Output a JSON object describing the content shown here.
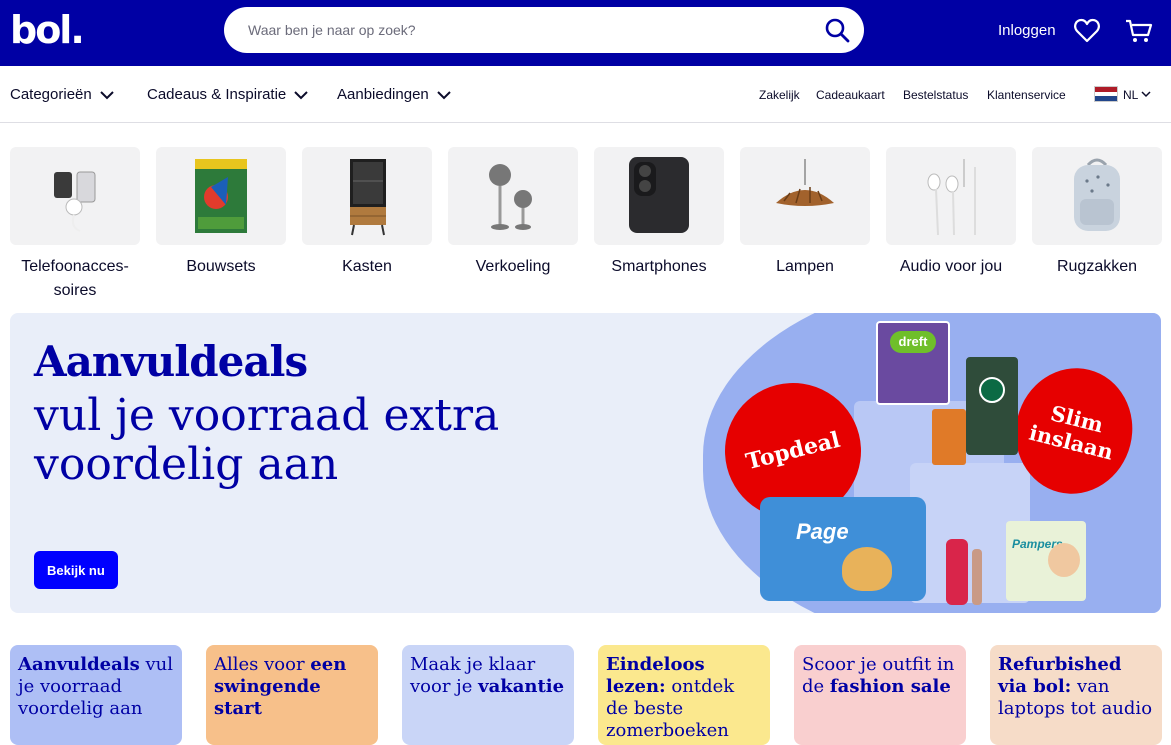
{
  "header": {
    "logo": "bol.",
    "search_placeholder": "Waar ben je naar op zoek?",
    "login_label": "Inloggen"
  },
  "nav": {
    "left": [
      "Categorieën",
      "Cadeaus & Inspiratie",
      "Aanbiedingen"
    ],
    "right": [
      "Zakelijk",
      "Cadeaukaart",
      "Bestelstatus",
      "Klantenservice"
    ],
    "language": "NL"
  },
  "categories": [
    {
      "label": "Telefoonacces-\nsoires",
      "icon": "phone-accessories-icon"
    },
    {
      "label": "Bouwsets",
      "icon": "building-set-icon"
    },
    {
      "label": "Kasten",
      "icon": "cabinet-icon"
    },
    {
      "label": "Verkoeling",
      "icon": "fan-icon"
    },
    {
      "label": "Smartphones",
      "icon": "smartphone-icon"
    },
    {
      "label": "Lampen",
      "icon": "lamp-icon"
    },
    {
      "label": "Audio voor jou",
      "icon": "earphones-icon"
    },
    {
      "label": "Rugzakken",
      "icon": "backpack-icon"
    }
  ],
  "hero": {
    "title": "Aanvuldeals",
    "subtitle": "vul je voorraad extra voordelig aan",
    "cta": "Bekijk nu",
    "badge_left": "Topdeal",
    "badge_right": "Slim inslaan",
    "product_labels": [
      "dreft",
      "Page",
      "Pampers"
    ]
  },
  "promos": [
    {
      "bold": "Aanvuldeals",
      "text": " vul je voorraad voordelig aan",
      "bold_first": true,
      "bg": "#aebff5"
    },
    {
      "text": "Alles voor ",
      "bold": "een swingende start",
      "bold_first": false,
      "bg": "#f7c08a"
    },
    {
      "text": "Maak je klaar voor je ",
      "bold": "vakantie",
      "bold_first": false,
      "bg": "#c9d5f7"
    },
    {
      "bold": "Eindeloos lezen:",
      "text": " ontdek de beste zomerboeken",
      "bold_first": true,
      "bg": "#fbe88e"
    },
    {
      "text": "Scoor je outfit in de ",
      "bold": "fashion sale",
      "bold_first": false,
      "bg": "#f9cfcf"
    },
    {
      "bold": "Refurbished via bol:",
      "text": " van laptops tot audio",
      "bold_first": true,
      "bg": "#f6dcc8"
    }
  ],
  "colors": {
    "brand": "#0000a4",
    "cta": "#0000ff",
    "deal_red": "#e60000"
  }
}
